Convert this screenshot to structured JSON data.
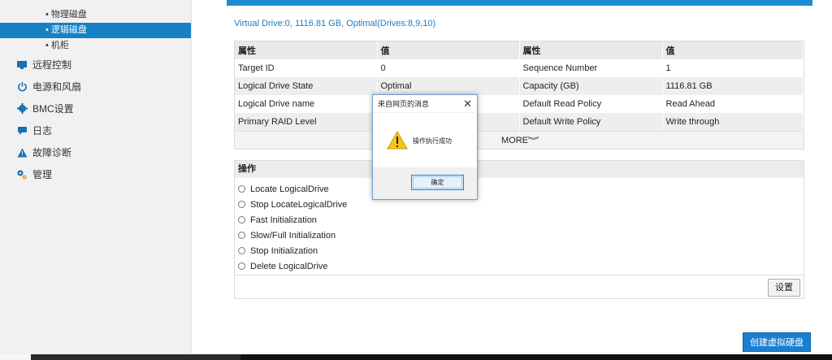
{
  "sidebar": {
    "sub_items": [
      {
        "label": "物理磁盘",
        "active": false
      },
      {
        "label": "逻辑磁盘",
        "active": true
      },
      {
        "label": "机柜",
        "active": false
      }
    ],
    "items": [
      {
        "label": "远程控制",
        "icon": "monitor-icon"
      },
      {
        "label": "电源和风扇",
        "icon": "power-icon"
      },
      {
        "label": "BMC设置",
        "icon": "gear-icon"
      },
      {
        "label": "日志",
        "icon": "log-icon"
      },
      {
        "label": "故障诊断",
        "icon": "warning-icon"
      },
      {
        "label": "管理",
        "icon": "manage-icon"
      }
    ]
  },
  "main": {
    "vd_title": "Virtual Drive:0, 1116.81 GB, Optimal(Drives:8,9,10)",
    "props": {
      "headers": [
        "属性",
        "值",
        "属性",
        "值"
      ],
      "rows": [
        [
          "Target ID",
          "0",
          "Sequence Number",
          "1"
        ],
        [
          "Logical Drive State",
          "Optimal",
          "Capacity (GB)",
          "1116.81 GB"
        ],
        [
          "Logical Drive name",
          "",
          "Default Read Policy",
          "Read Ahead"
        ],
        [
          "Primary RAID Level",
          "",
          "Default Write Policy",
          "Write through"
        ]
      ],
      "more_label": "MORE"
    },
    "ops": {
      "header": "操作",
      "options": [
        "Locate LogicalDrive",
        "Stop LocateLogicalDrive",
        "Fast Initialization",
        "Slow/Full Initialization",
        "Stop Initialization",
        "Delete LogicalDrive"
      ],
      "settings_label": "设置"
    },
    "create_label": "创建虚拟硬盘"
  },
  "dialog": {
    "title": "来自网页的消息",
    "close": "✕",
    "message": "操作执行成功",
    "ok_label": "确定"
  },
  "colors": {
    "accent": "#1d8bd1",
    "active_nav": "#1681c4"
  }
}
